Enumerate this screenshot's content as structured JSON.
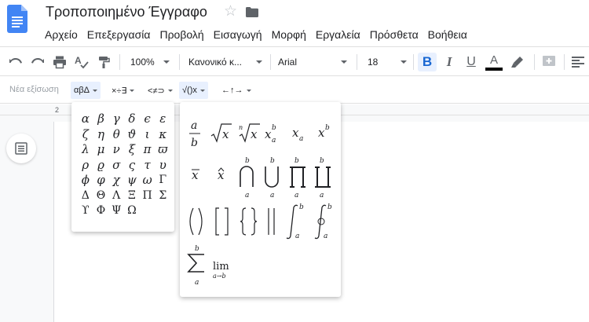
{
  "title": "Τροποποιημένο Έγγραφο",
  "menu": [
    "Αρχείο",
    "Επεξεργασία",
    "Προβολή",
    "Εισαγωγή",
    "Μορφή",
    "Εργαλεία",
    "Πρόσθετα",
    "Βοήθεια"
  ],
  "toolbar": {
    "zoom": "100%",
    "style": "Κανονικό κ...",
    "font": "Arial",
    "size": "18",
    "bold": "B",
    "italic": "I",
    "underline": "U",
    "text_color": "A"
  },
  "equation_toolbar": {
    "new_equation": "Νέα εξίσωση",
    "tabs": [
      "αβΔ",
      "×÷∃",
      "<≠⊃",
      "√()x",
      "←↑→"
    ]
  },
  "ruler": {
    "label": "2"
  },
  "greek_symbols": [
    "α",
    "β",
    "γ",
    "δ",
    "ϵ",
    "ε",
    "ζ",
    "η",
    "θ",
    "ϑ",
    "ι",
    "κ",
    "λ",
    "μ",
    "ν",
    "ξ",
    "π",
    "ϖ",
    "ρ",
    "ϱ",
    "σ",
    "ς",
    "τ",
    "υ",
    "ϕ",
    "φ",
    "χ",
    "ψ",
    "ω",
    "Γ",
    "Δ",
    "Θ",
    "Λ",
    "Ξ",
    "Π",
    "Σ",
    "ϒ",
    "Φ",
    "Ψ",
    "Ω"
  ],
  "math_labels": {
    "var_x": "x",
    "var_a": "a",
    "var_b": "b",
    "lim": "lim",
    "lim_sub": "a→b",
    "root_n": "n"
  },
  "colors": {
    "accent": "#1a73e8",
    "active_bg": "#e8f0fe",
    "icon": "#5f6368",
    "text": "#202124"
  }
}
